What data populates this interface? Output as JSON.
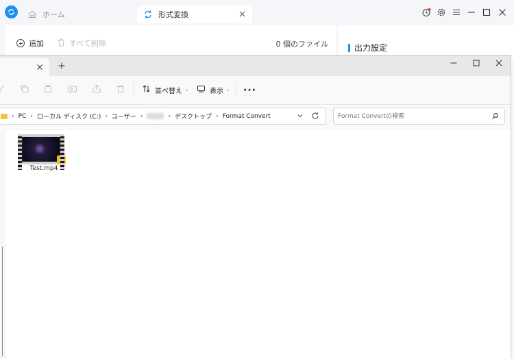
{
  "app": {
    "tabs": [
      {
        "label": "ホーム",
        "icon": "home-icon"
      },
      {
        "label": "形式変換",
        "icon": "convert-icon"
      }
    ],
    "toolbar": {
      "add_label": "追加",
      "delete_all_label": "すべて削除",
      "file_count": "0 個のファイル"
    },
    "output_settings_title": "出力設定",
    "accent_color": "#1e8ff0"
  },
  "explorer": {
    "toolbar": {
      "sort_label": "並べ替え",
      "view_label": "表示"
    },
    "breadcrumb": [
      "PC",
      "ローカル ディスク (C:)",
      "ユーザー",
      "デスクトップ",
      "Format Convert"
    ],
    "search_placeholder": "Format Convertの検索",
    "files": [
      {
        "name": "Test.mp4",
        "type": "video"
      }
    ]
  }
}
